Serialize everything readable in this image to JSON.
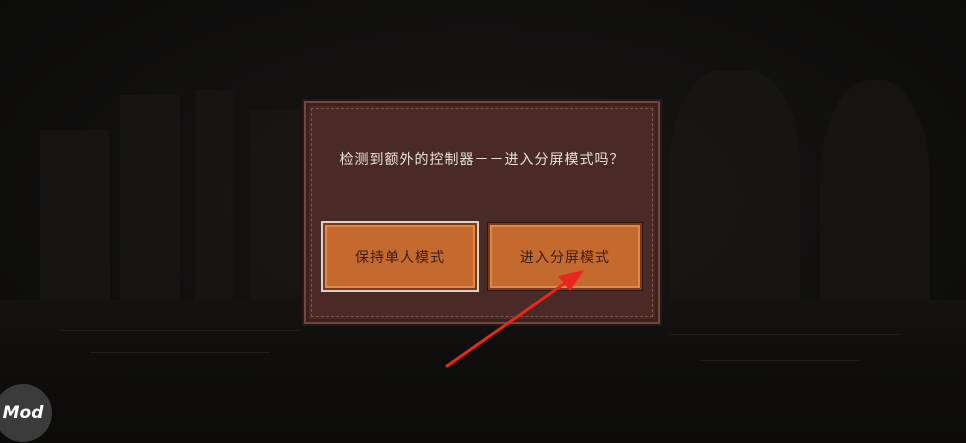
{
  "dialog": {
    "message": "检测到额外的控制器－－进入分屏模式吗？",
    "buttons": {
      "single_player": "保持单人模式",
      "split_screen": "进入分屏模式"
    }
  },
  "badge": {
    "label": "Mod"
  },
  "annotation": {
    "arrow_color": "#e8281e"
  },
  "colors": {
    "dialog_bg": "#4a2a27",
    "button_bg": "#c56a2e"
  }
}
